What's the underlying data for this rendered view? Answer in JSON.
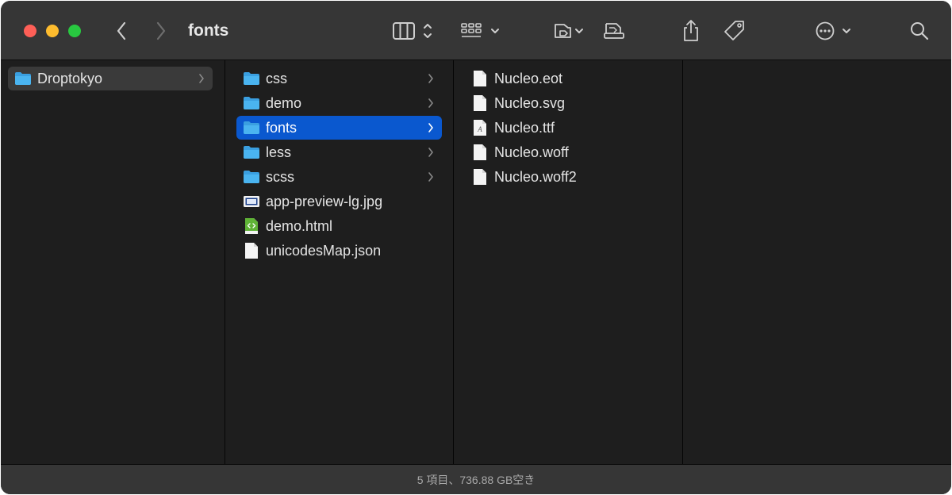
{
  "window": {
    "title": "fonts"
  },
  "toolbar": {
    "buttons": [
      {
        "name": "back",
        "icon": "chevron-left-icon"
      },
      {
        "name": "forward",
        "icon": "chevron-right-icon"
      },
      {
        "name": "view-columns",
        "icon": "columns-view-icon"
      },
      {
        "name": "group",
        "icon": "grid-group-icon"
      },
      {
        "name": "tag-folder",
        "icon": "folder-tag-icon"
      },
      {
        "name": "drive",
        "icon": "drive-icon"
      },
      {
        "name": "share",
        "icon": "share-icon"
      },
      {
        "name": "tag",
        "icon": "tag-icon"
      },
      {
        "name": "more",
        "icon": "ellipsis-circle-icon"
      },
      {
        "name": "search",
        "icon": "search-icon"
      }
    ]
  },
  "columns": {
    "col0": [
      {
        "label": "Droptokyo",
        "icon": "folder-icon",
        "has_children": true,
        "selected": "inactive"
      }
    ],
    "col1": [
      {
        "label": "css",
        "icon": "folder-icon",
        "has_children": true
      },
      {
        "label": "demo",
        "icon": "folder-icon",
        "has_children": true
      },
      {
        "label": "fonts",
        "icon": "folder-icon",
        "has_children": true,
        "selected": "active"
      },
      {
        "label": "less",
        "icon": "folder-icon",
        "has_children": true
      },
      {
        "label": "scss",
        "icon": "folder-icon",
        "has_children": true
      },
      {
        "label": "app-preview-lg.jpg",
        "icon": "image-file-icon"
      },
      {
        "label": "demo.html",
        "icon": "html-file-icon"
      },
      {
        "label": "unicodesMap.json",
        "icon": "document-icon"
      }
    ],
    "col2": [
      {
        "label": "Nucleo.eot",
        "icon": "document-icon"
      },
      {
        "label": "Nucleo.svg",
        "icon": "document-icon"
      },
      {
        "label": "Nucleo.ttf",
        "icon": "font-file-icon"
      },
      {
        "label": "Nucleo.woff",
        "icon": "document-icon"
      },
      {
        "label": "Nucleo.woff2",
        "icon": "document-icon"
      }
    ]
  },
  "status": {
    "text": "5 項目、736.88 GB空き"
  },
  "colors": {
    "folder": "#4ab4f0",
    "selection_active": "#0a58cf",
    "selection_inactive": "#3a3a3a"
  }
}
